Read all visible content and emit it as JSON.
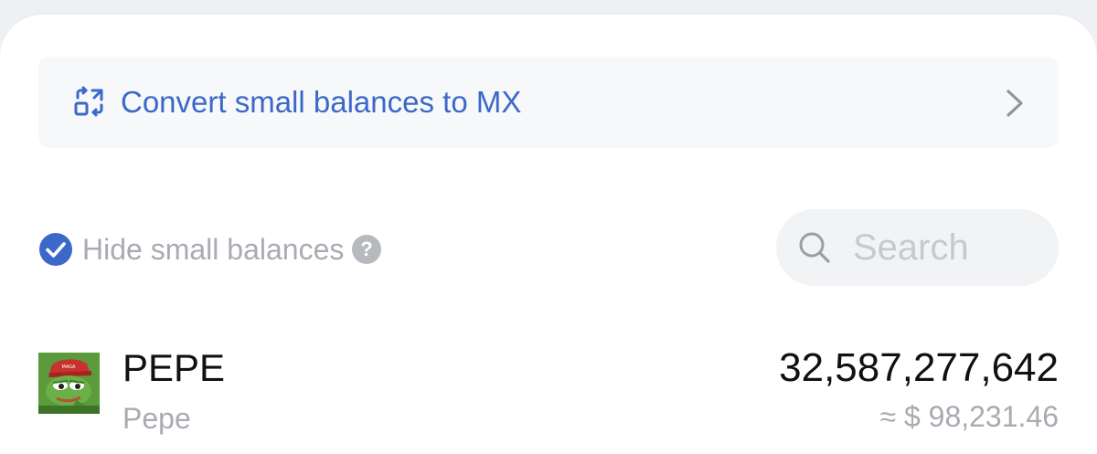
{
  "convert_banner": {
    "label": "Convert small balances to MX",
    "icon": "convert-icon",
    "accent_color": "#3b68c9"
  },
  "filters": {
    "hide_small_balances_label": "Hide small balances",
    "hide_small_balances_checked": true,
    "help_icon": "question-circle-icon"
  },
  "search": {
    "placeholder": "Search",
    "value": ""
  },
  "assets": [
    {
      "symbol": "PEPE",
      "name": "Pepe",
      "amount": "32,587,277,642",
      "usd_value": "≈ $ 98,231.46",
      "logo": "pepe-frog-logo"
    }
  ]
}
